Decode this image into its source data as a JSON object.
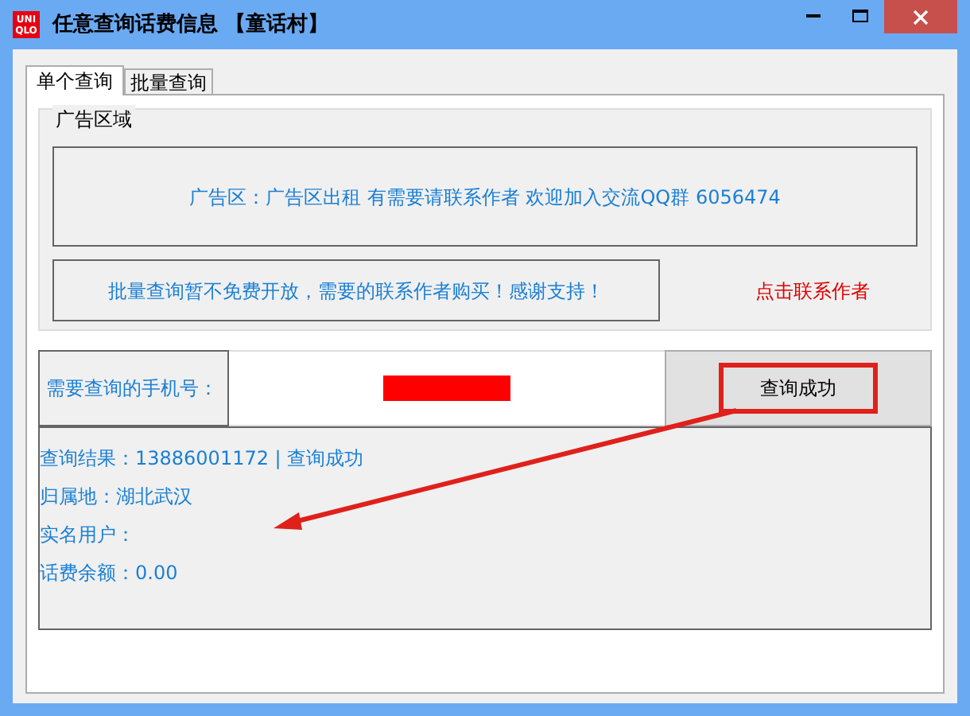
{
  "window": {
    "title": "任意查询话费信息 【童话村】",
    "logo": [
      "UNI",
      "QLO"
    ]
  },
  "tabs": [
    {
      "label": "单个查询",
      "selected": true
    },
    {
      "label": "批量查询",
      "selected": false
    }
  ],
  "ad_group": {
    "title": "广告区域",
    "ad_text": "广告区：广告区出租  有需要请联系作者 欢迎加入交流QQ群 6056474",
    "notice_text": "批量查询暂不免费开放，需要的联系作者购买！感谢支持！",
    "contact_link": "点击联系作者"
  },
  "query": {
    "label": "需要查询的手机号：",
    "button": "查询成功"
  },
  "results": [
    {
      "label": "查询结果：",
      "value": "13886001172 | 查询成功"
    },
    {
      "label": "归属地：",
      "value": "湖北武汉"
    },
    {
      "label": "实名用户："
    },
    {
      "label": "话费余额：",
      "value": "0.00"
    }
  ]
}
